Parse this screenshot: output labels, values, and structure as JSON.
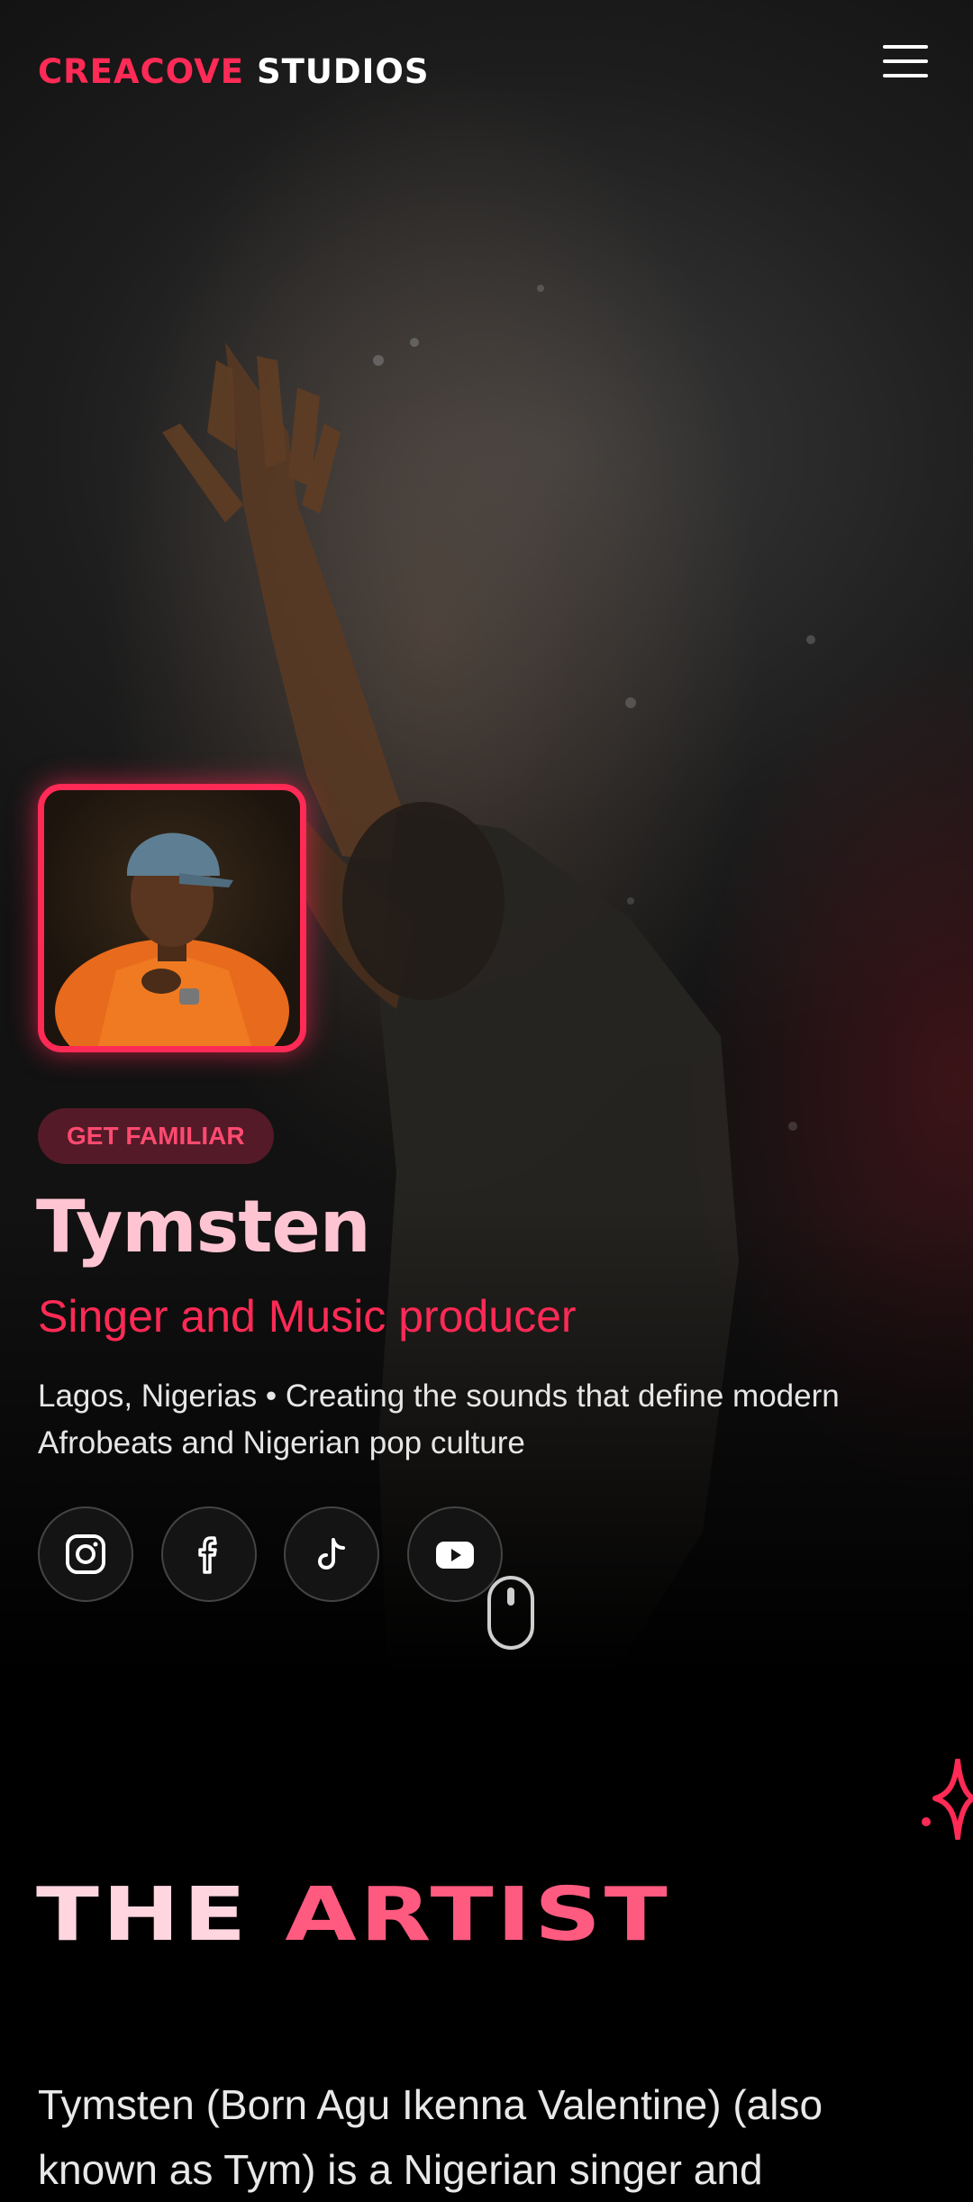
{
  "navbar": {
    "brand_accent": "CREACOVE",
    "brand_rest": " STUDIOS",
    "menu_icon": "hamburger-menu-icon"
  },
  "hero": {
    "badge": "GET FAMILIAR",
    "name": "Tymsten",
    "role": "Singer and Music producer",
    "description": "Lagos, Nigerias • Creating the sounds that define modern Afrobeats and Nigerian pop culture",
    "socials": [
      {
        "name": "instagram",
        "icon": "instagram-icon"
      },
      {
        "name": "facebook",
        "icon": "facebook-icon"
      },
      {
        "name": "tiktok",
        "icon": "tiktok-icon"
      },
      {
        "name": "youtube",
        "icon": "youtube-icon"
      }
    ],
    "scroll_icon": "mouse-scroll-icon"
  },
  "about": {
    "title_word1": "THE",
    "title_word2": "ARTIST",
    "text": "Tymsten (Born Agu Ikenna Valentine) (also known as Tym) is a Nigerian singer and",
    "decor_icon": "sparkle-icon"
  },
  "colors": {
    "accent": "#ff2a55",
    "name": "#ffc4d2",
    "background": "#000000"
  }
}
